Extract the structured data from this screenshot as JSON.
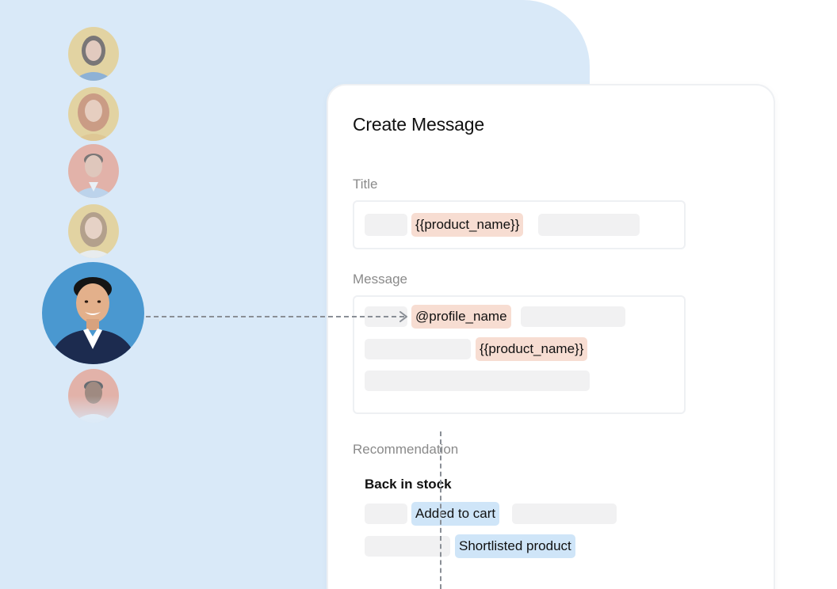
{
  "card": {
    "title": "Create Message"
  },
  "fields": {
    "title_label": "Title",
    "title_chip": "{{product_name}}",
    "message_label": "Message",
    "message_chip_profile": "@profile_name",
    "message_chip_product": "{{product_name}}"
  },
  "recommendation": {
    "label": "Recommendation",
    "heading": "Back in stock",
    "chip_added": "Added to cart",
    "chip_shortlisted": "Shortlisted product"
  },
  "colors": {
    "panel_bg": "#d9e9f8",
    "variable_chip": "#f7ddd2",
    "recommendation_chip": "#cfe5f8",
    "placeholder": "#f1f1f2",
    "connector": "#8a8f96"
  },
  "icons": [
    "profile-avatar",
    "arrow-right-icon"
  ]
}
